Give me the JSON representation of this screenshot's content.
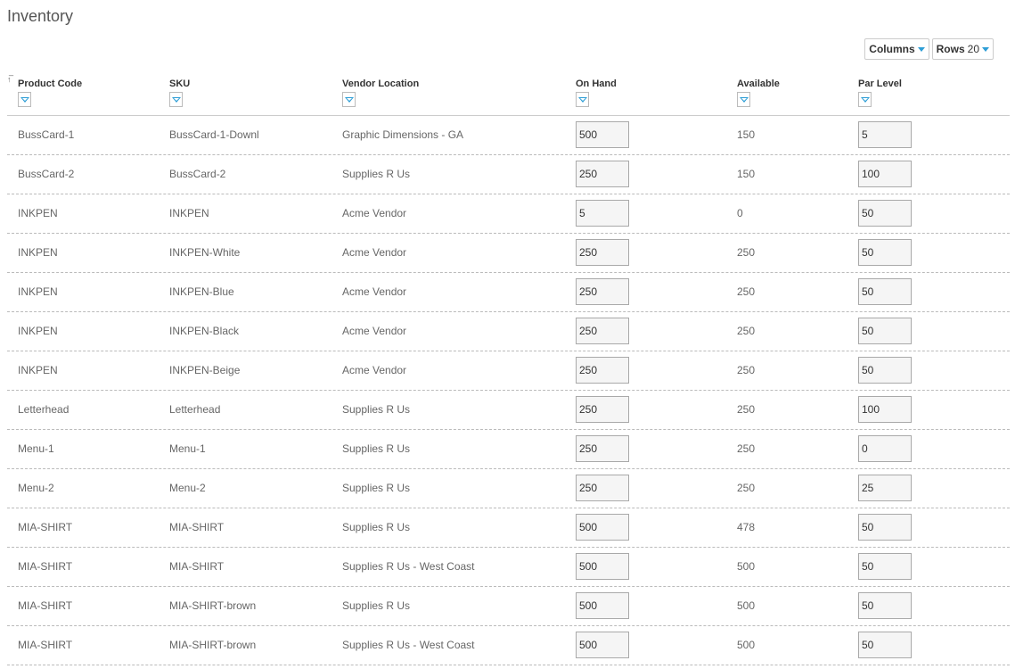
{
  "page": {
    "title": "Inventory"
  },
  "toolbar": {
    "columns_label": "Columns",
    "rows_label": "Rows",
    "rows_value": "20"
  },
  "icons": {
    "sort": "sort-icon",
    "filter": "filter-icon",
    "dropdown": "chevron-down-icon"
  },
  "colors": {
    "accent": "#2e9ed6"
  },
  "table": {
    "columns": [
      "Product Code",
      "SKU",
      "Vendor Location",
      "On Hand",
      "Available",
      "Par Level"
    ],
    "rows": [
      {
        "product_code": "BussCard-1",
        "sku": "BussCard-1-Downl",
        "vendor_location": "Graphic Dimensions - GA",
        "on_hand": "500",
        "available": "150",
        "par_level": "5"
      },
      {
        "product_code": "BussCard-2",
        "sku": "BussCard-2",
        "vendor_location": "Supplies R Us",
        "on_hand": "250",
        "available": "150",
        "par_level": "100"
      },
      {
        "product_code": "INKPEN",
        "sku": "INKPEN",
        "vendor_location": "Acme Vendor",
        "on_hand": "5",
        "available": "0",
        "par_level": "50"
      },
      {
        "product_code": "INKPEN",
        "sku": "INKPEN-White",
        "vendor_location": "Acme Vendor",
        "on_hand": "250",
        "available": "250",
        "par_level": "50"
      },
      {
        "product_code": "INKPEN",
        "sku": "INKPEN-Blue",
        "vendor_location": "Acme Vendor",
        "on_hand": "250",
        "available": "250",
        "par_level": "50"
      },
      {
        "product_code": "INKPEN",
        "sku": "INKPEN-Black",
        "vendor_location": "Acme Vendor",
        "on_hand": "250",
        "available": "250",
        "par_level": "50"
      },
      {
        "product_code": "INKPEN",
        "sku": "INKPEN-Beige",
        "vendor_location": "Acme Vendor",
        "on_hand": "250",
        "available": "250",
        "par_level": "50"
      },
      {
        "product_code": "Letterhead",
        "sku": "Letterhead",
        "vendor_location": "Supplies R Us",
        "on_hand": "250",
        "available": "250",
        "par_level": "100"
      },
      {
        "product_code": "Menu-1",
        "sku": "Menu-1",
        "vendor_location": "Supplies R Us",
        "on_hand": "250",
        "available": "250",
        "par_level": "0"
      },
      {
        "product_code": "Menu-2",
        "sku": "Menu-2",
        "vendor_location": "Supplies R Us",
        "on_hand": "250",
        "available": "250",
        "par_level": "25"
      },
      {
        "product_code": "MIA-SHIRT",
        "sku": "MIA-SHIRT",
        "vendor_location": "Supplies R Us",
        "on_hand": "500",
        "available": "478",
        "par_level": "50"
      },
      {
        "product_code": "MIA-SHIRT",
        "sku": "MIA-SHIRT",
        "vendor_location": "Supplies R Us - West Coast",
        "on_hand": "500",
        "available": "500",
        "par_level": "50"
      },
      {
        "product_code": "MIA-SHIRT",
        "sku": "MIA-SHIRT-brown",
        "vendor_location": "Supplies R Us",
        "on_hand": "500",
        "available": "500",
        "par_level": "50"
      },
      {
        "product_code": "MIA-SHIRT",
        "sku": "MIA-SHIRT-brown",
        "vendor_location": "Supplies R Us - West Coast",
        "on_hand": "500",
        "available": "500",
        "par_level": "50"
      }
    ]
  }
}
